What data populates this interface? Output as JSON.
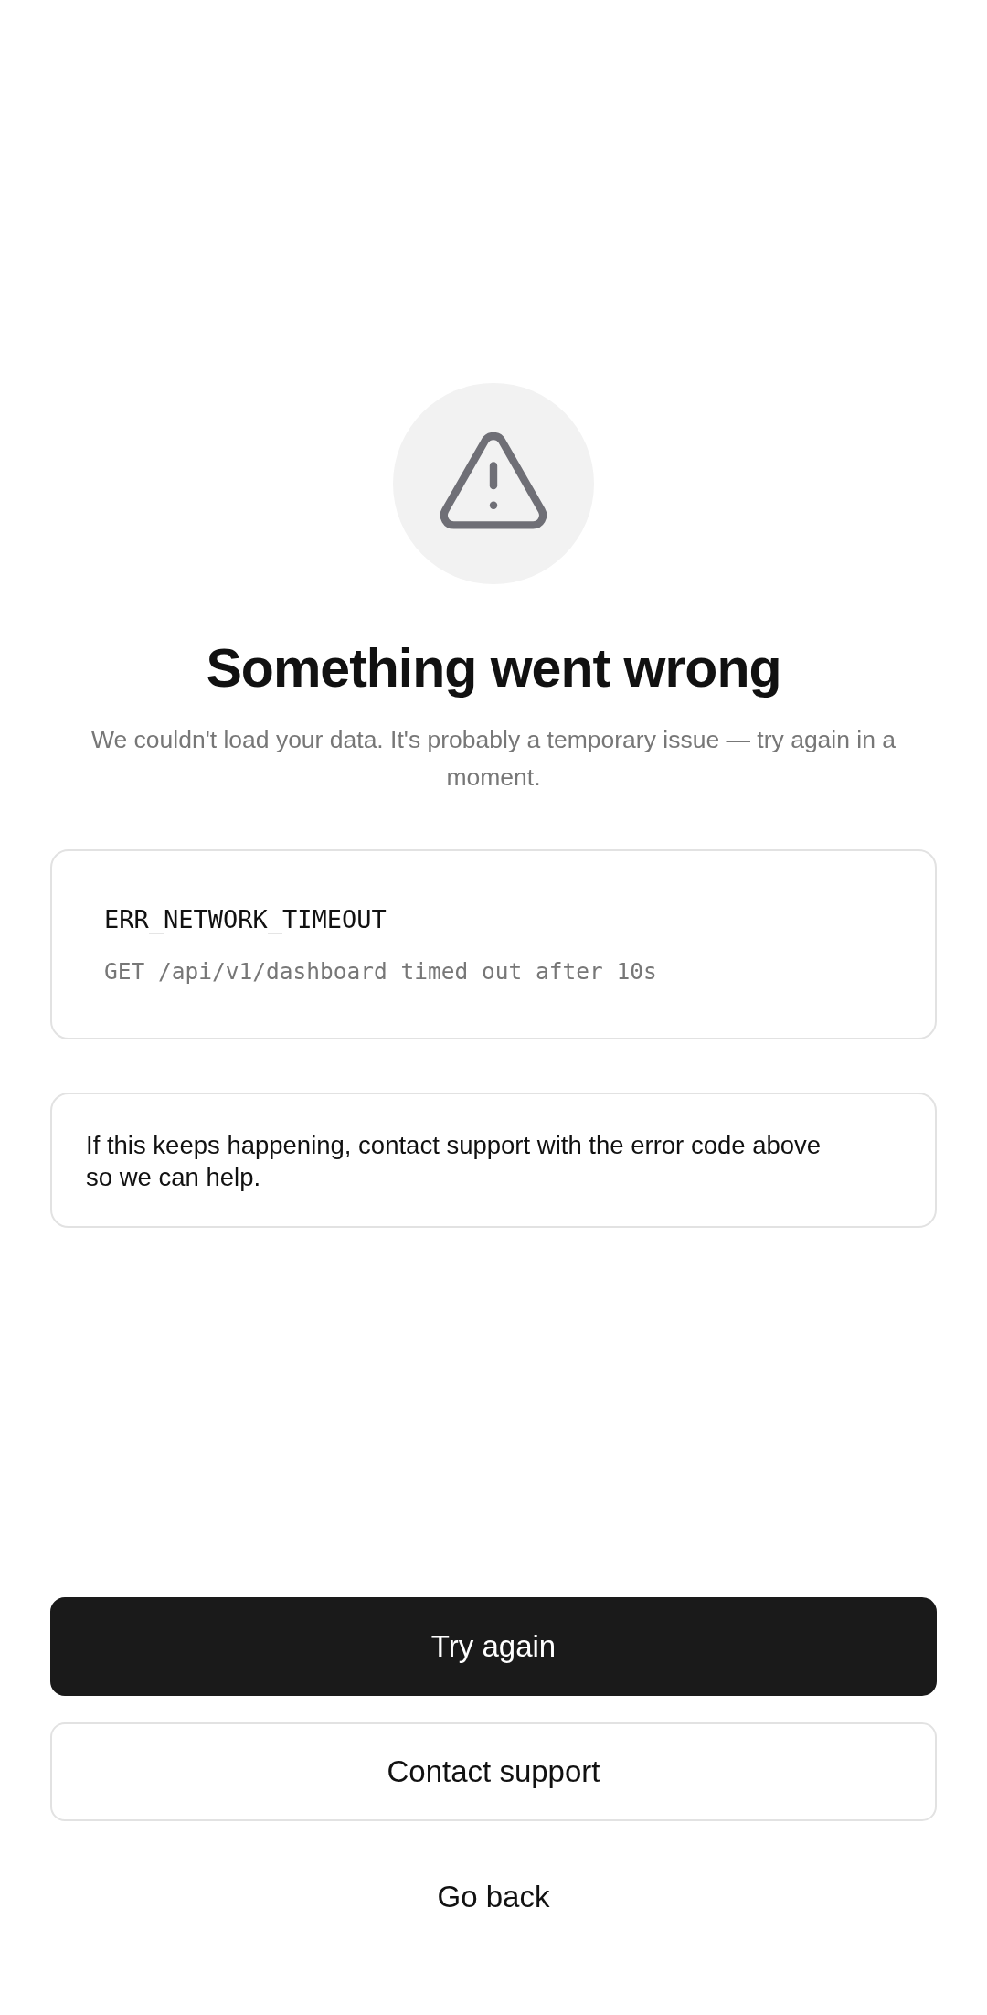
{
  "title": "Something went wrong",
  "message": "We couldn't load your data. It's probably a temporary issue — try again in a moment.",
  "error_card": {
    "code": "ERR_NETWORK_TIMEOUT",
    "detail": "GET /api/v1/dashboard timed out after 10s"
  },
  "help_note": "If this keeps happening, contact support with the error code above so we can help.",
  "actions": [
    {
      "label": "Try again",
      "kind": "primary"
    },
    {
      "label": "Contact support",
      "kind": "secondary"
    },
    {
      "label": "Go back",
      "kind": "text"
    }
  ]
}
